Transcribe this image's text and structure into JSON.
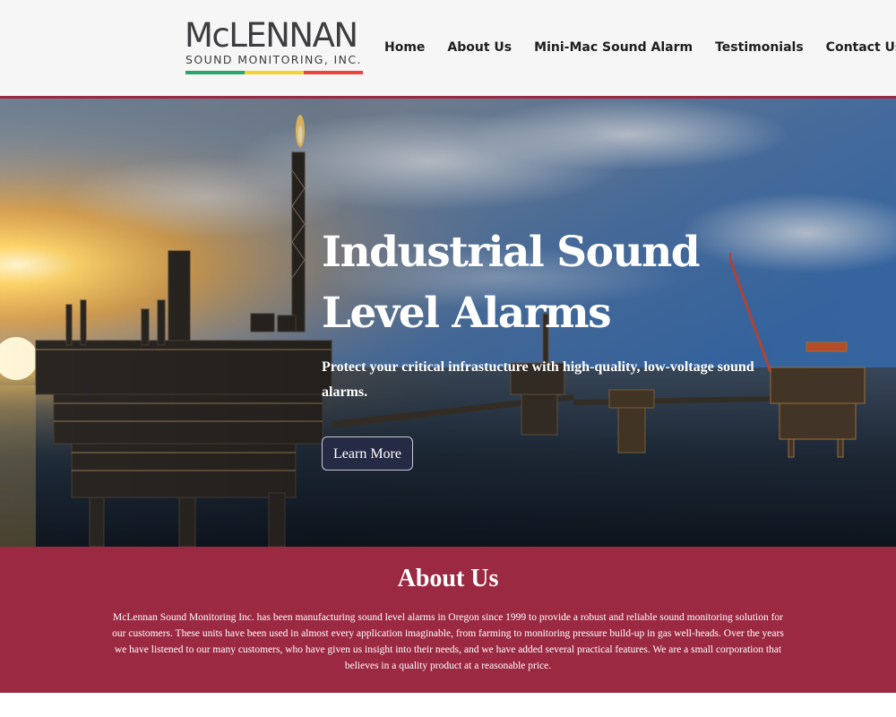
{
  "brand": {
    "name": "McLENNAN",
    "tagline": "SOUND MONITORING, INC.",
    "stripe_colors": [
      "#2aa56a",
      "#f2d42c",
      "#e8453c"
    ]
  },
  "nav": {
    "items": [
      {
        "label": "Home"
      },
      {
        "label": "About Us"
      },
      {
        "label": "Mini-Mac Sound Alarm"
      },
      {
        "label": "Testimonials"
      },
      {
        "label": "Contact Us"
      }
    ]
  },
  "hero": {
    "title_line1": "Industrial Sound",
    "title_line2": "Level Alarms",
    "subtitle": "Protect your critical infrastucture with high-quality, low-voltage sound alarms.",
    "button_label": "Learn More",
    "image_subject": "offshore-oil-platform-at-sunset"
  },
  "about": {
    "title": "About Us",
    "body": "McLennan Sound Monitoring Inc. has been manufacturing sound level alarms in Oregon since 1999 to provide a robust and reliable sound monitoring solution for our customers. These units have been used in almost every application imaginable, from farming to monitoring pressure build-up in gas well-heads.  Over the years we have listened to our many customers, who have given us insight into their needs, and we have added several practical features. We are a small corporation that believes in a quality product at a reasonable price."
  },
  "colors": {
    "accent": "#9b2942",
    "header_bg": "#f6f6f6",
    "button_bg": "#262b45",
    "text_dark": "#1e1e1e"
  }
}
